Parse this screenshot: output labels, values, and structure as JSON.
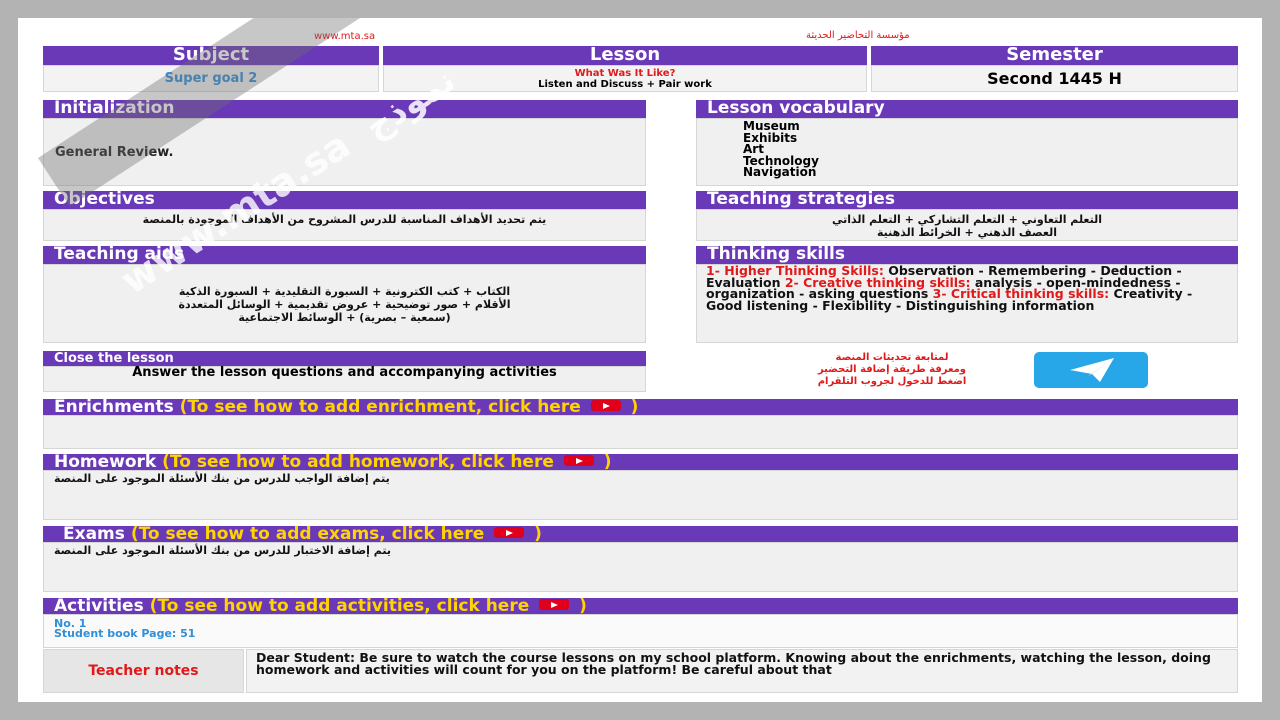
{
  "top": {
    "left_url": "www.mta.sa",
    "right_text": "مؤسسة التحاضير الحديثة"
  },
  "header": {
    "subject_label": "Subject",
    "lesson_label": "Lesson",
    "semester_label": "Semester",
    "subject_value": "Super goal 2",
    "lesson_title": "What Was It Like?",
    "lesson_sub": "Listen and Discuss + Pair work",
    "semester_value": "Second 1445 H"
  },
  "initialization": {
    "title": "Initialization",
    "text": "General Review."
  },
  "vocabulary": {
    "title": "Lesson vocabulary",
    "items": [
      "Museum",
      "Exhibits",
      "Art",
      "Technology",
      "Navigation"
    ]
  },
  "objectives": {
    "title": "Objectives",
    "text": "يتم تحديد الأهداف المناسبة للدرس المشروح من الأهداف الموجودة بالمنصة"
  },
  "strategies": {
    "title": "Teaching strategies",
    "line1": "التعلم التعاوني + التعلم التشاركي + التعلم الذاتي",
    "line2": "العصف الذهني + الخرائط الذهنية"
  },
  "aids": {
    "title": "Teaching aids",
    "line1": "الكتاب + كتب الكترونية + السبورة التقليدية + السبورة الذكية",
    "line2": "الأقلام + صور توضيحية + عروض تقديمية + الوسائل المتعددة",
    "line3": "(سمعية – بصرية) + الوسائط الاجتماعية"
  },
  "thinking": {
    "title": "Thinking skills",
    "s1_label": "1- Higher Thinking Skills:",
    "s1_text": "Observation - Remembering - Deduction - Evaluation",
    "s2_label": "2- Creative thinking skills:",
    "s2_text": "analysis - open-mindedness - organization - asking questions",
    "s3_label": "3- Critical thinking skills:",
    "s3_text": "Creativity - Good listening - Flexibility - Distinguishing information"
  },
  "close": {
    "title": "Close the lesson",
    "text": "Answer the lesson questions and accompanying activities"
  },
  "telegram": {
    "line1": "لمتابعة تحديثات المنصة",
    "line2": "ومعرفة طريقة إضافة التحضير",
    "line3": "اضغط للدخول لجروب التلقرام",
    "icon": "telegram-icon",
    "color": "#27a7e7"
  },
  "enrichments": {
    "title": "Enrichments",
    "link": "(To see how to add enrichment, click here",
    "close": ")"
  },
  "homework": {
    "title": "Homework",
    "link": "(To see how to add homework, click here",
    "close": ")",
    "text": "يتم إضافة الواجب للدرس من بنك الأسئلة الموجود على المنصة"
  },
  "exams": {
    "title": "Exams",
    "link": "(To see how to add exams, click here",
    "close": ")",
    "text": "يتم إضافة الاختبار للدرس من بنك الأسئلة الموجود على المنصة"
  },
  "activities": {
    "title": "Activities",
    "link": "(To see how to add activities, click here",
    "close": ")",
    "no": "No. 1",
    "page": "Student book Page: 51"
  },
  "notes": {
    "label": "Teacher notes",
    "text": "Dear Student: Be sure to watch the course lessons on my school platform. Knowing about the enrichments, watching the lesson, doing homework and activities will count for you on the platform! Be careful about that"
  },
  "watermark": {
    "text": "www.mta.sa",
    "ar": "نموذج"
  },
  "colors": {
    "header": "#6a39b8",
    "link_yellow": "#ffd400",
    "accent_red": "#e01a1a",
    "value_blue": "#2f8fd8"
  }
}
